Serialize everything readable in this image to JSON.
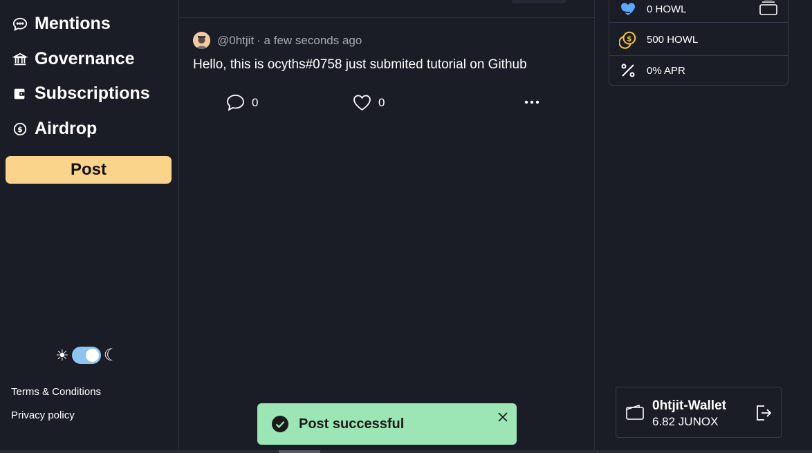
{
  "sidebar": {
    "items": [
      {
        "label": "Mentions",
        "icon": "chat-bubble-icon"
      },
      {
        "label": "Governance",
        "icon": "bank-icon"
      },
      {
        "label": "Subscriptions",
        "icon": "wallet-icon"
      },
      {
        "label": "Airdrop",
        "icon": "dollar-coin-icon"
      }
    ],
    "post_button": "Post",
    "theme_toggle": {
      "mode": "dark",
      "sun": "☀",
      "moon": "☾"
    },
    "terms": "Terms & Conditions",
    "privacy": "Privacy policy"
  },
  "post": {
    "handle": "@0htjit",
    "time": "· a few seconds ago",
    "text": "Hello, this is ocyths#0758 just submited tutorial on Github",
    "comments": "0",
    "likes": "0"
  },
  "stats": {
    "howl_staked": "0 HOWL",
    "howl_balance": "500 HOWL",
    "apr": "0% APR"
  },
  "wallet": {
    "name": "0htjit-Wallet",
    "balance": "6.82 JUNOX"
  },
  "toast": {
    "message": "Post successful"
  },
  "colors": {
    "background": "#1b1d26",
    "accent": "#fad48b",
    "toast": "#9be6b4",
    "heart": "#5aa8ff",
    "coin": "#f5c542"
  }
}
